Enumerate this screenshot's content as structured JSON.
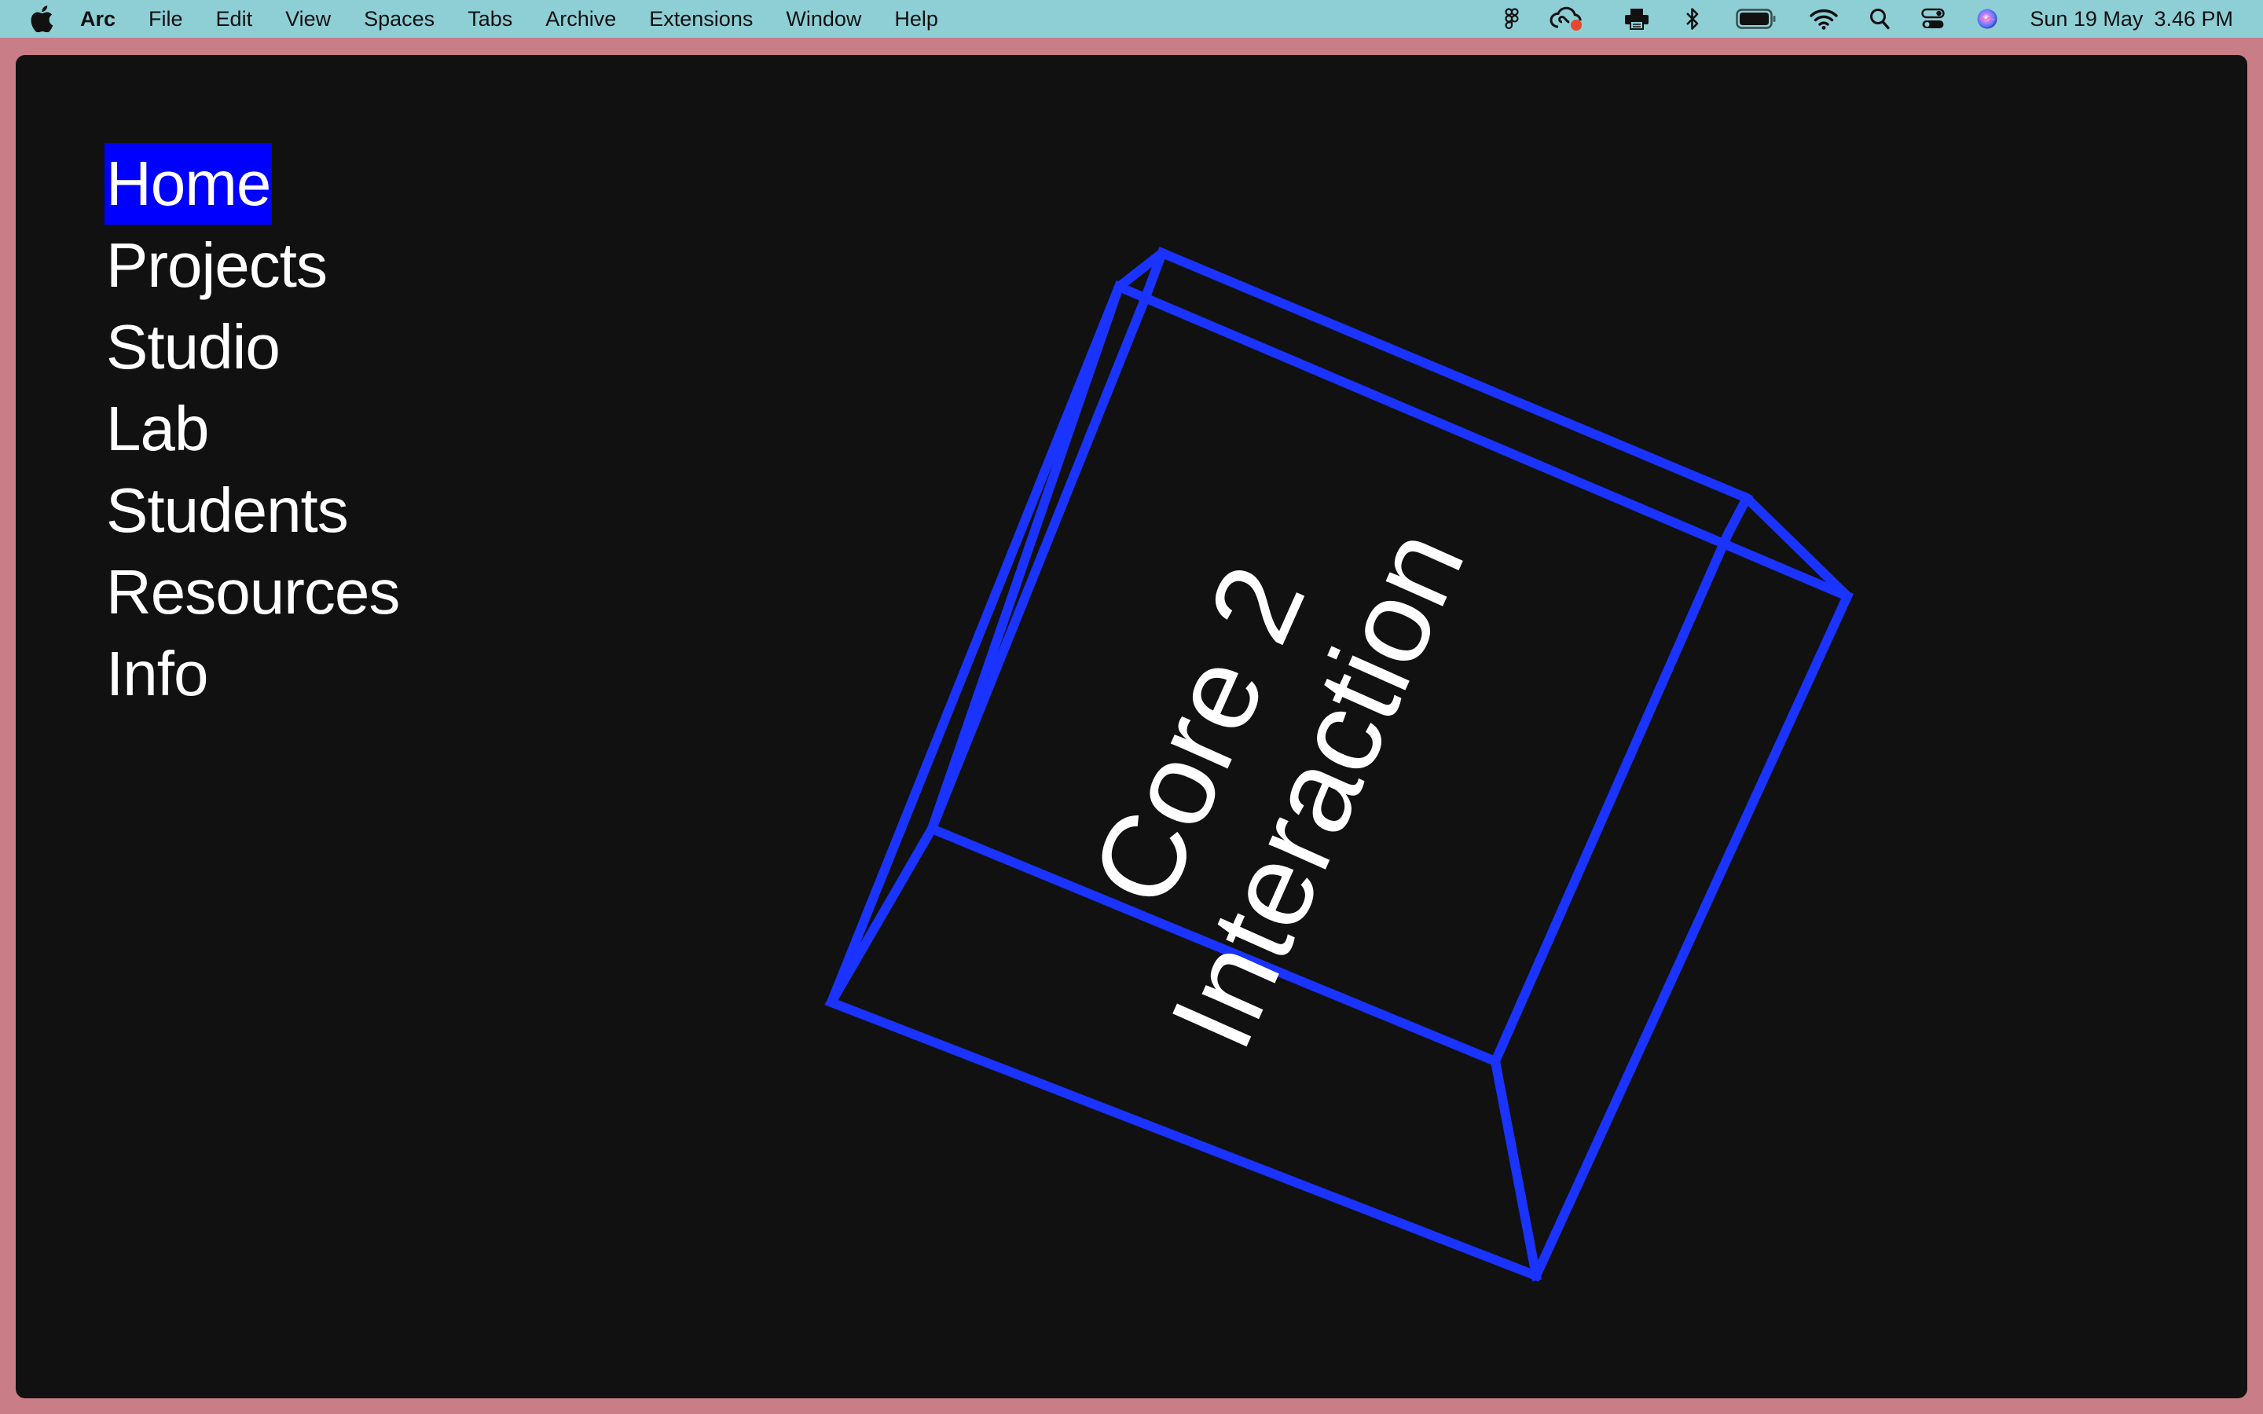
{
  "menubar": {
    "app_name": "Arc",
    "items": [
      "File",
      "Edit",
      "View",
      "Spaces",
      "Tabs",
      "Archive",
      "Extensions",
      "Window",
      "Help"
    ],
    "status_icons": [
      "figma-icon",
      "creative-cloud-icon",
      "printer-icon",
      "bluetooth-icon",
      "battery-icon",
      "wifi-icon",
      "spotlight-search-icon",
      "control-center-icon",
      "siri-icon"
    ],
    "date": "Sun 19 May",
    "time": "3.46 PM",
    "background_color": "#8ecfd6"
  },
  "window": {
    "frame_color": "#c97d86",
    "background_color": "#111112"
  },
  "site_nav": {
    "items": [
      {
        "label": "Home",
        "active": true
      },
      {
        "label": "Projects",
        "active": false
      },
      {
        "label": "Studio",
        "active": false
      },
      {
        "label": "Lab",
        "active": false
      },
      {
        "label": "Students",
        "active": false
      },
      {
        "label": "Resources",
        "active": false
      },
      {
        "label": "Info",
        "active": false
      }
    ],
    "active_highlight_color": "#0000ff"
  },
  "hero": {
    "title_line_1": "Core 2",
    "title_line_2": "Interaction",
    "shape": "wireframe-box-icon",
    "shape_color": "#1a33ff"
  }
}
